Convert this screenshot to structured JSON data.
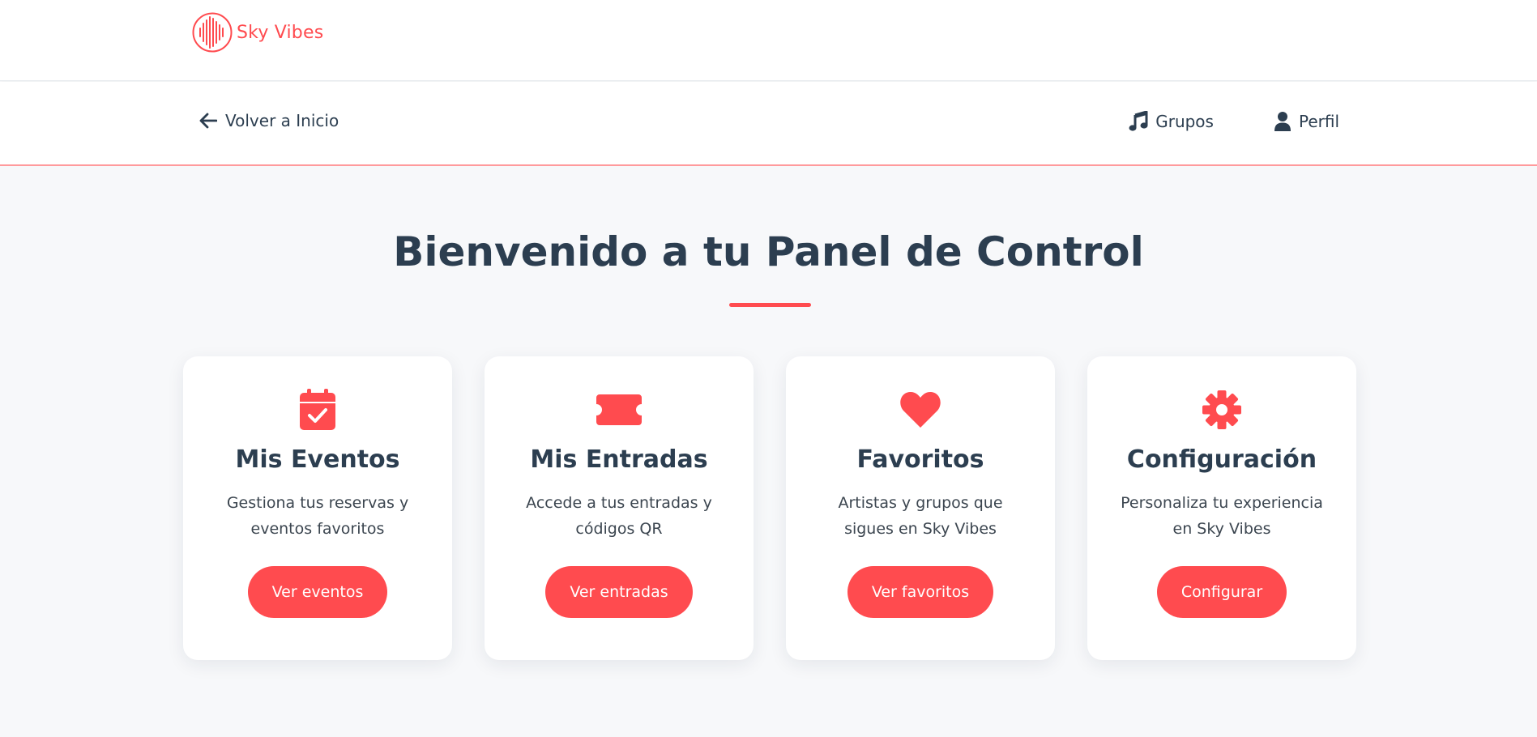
{
  "brand": {
    "name": "Sky Vibes",
    "accent_color": "#ff4b4f"
  },
  "subnav": {
    "back_label": "Volver a Inicio",
    "back_icon": "arrow-left-icon",
    "items": [
      {
        "label": "Grupos",
        "icon": "music-note-icon"
      },
      {
        "label": "Perfil",
        "icon": "user-icon"
      }
    ]
  },
  "main": {
    "title": "Bienvenido a tu Panel de Control",
    "cards": [
      {
        "icon": "calendar-check-icon",
        "title": "Mis Eventos",
        "description": "Gestiona tus reservas y eventos favoritos",
        "button": "Ver eventos"
      },
      {
        "icon": "ticket-icon",
        "title": "Mis Entradas",
        "description": "Accede a tus entradas y códigos QR",
        "button": "Ver entradas"
      },
      {
        "icon": "heart-icon",
        "title": "Favoritos",
        "description": "Artistas y grupos que sigues en Sky Vibes",
        "button": "Ver favoritos"
      },
      {
        "icon": "gear-icon",
        "title": "Configuración",
        "description": "Personaliza tu experiencia en Sky Vibes",
        "button": "Configurar"
      }
    ]
  }
}
